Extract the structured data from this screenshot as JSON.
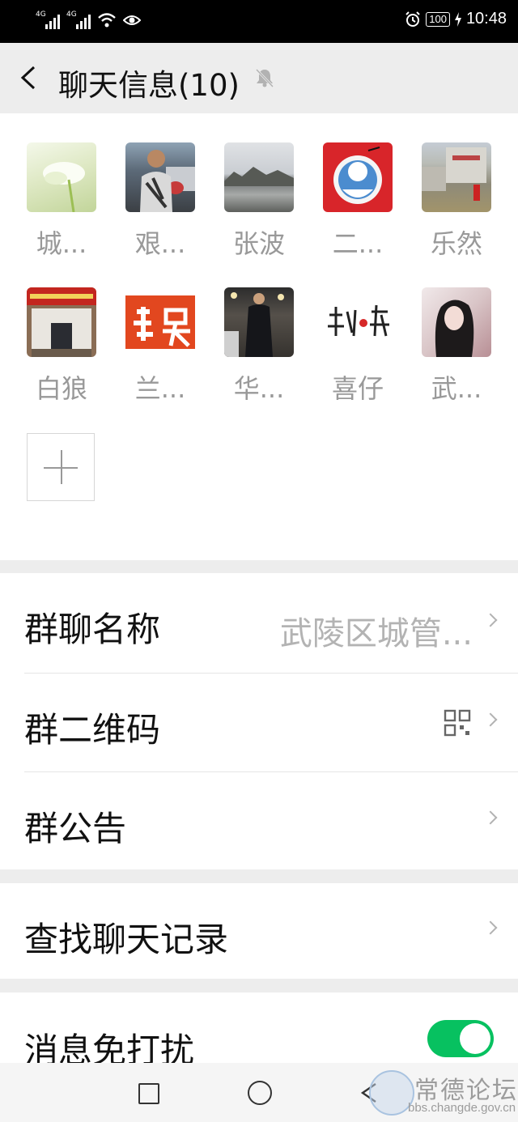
{
  "status_bar": {
    "signal1_tag": "4G",
    "signal2_tag": "4G",
    "battery": "100",
    "time": "10:48"
  },
  "header": {
    "title": "聊天信息(10)"
  },
  "members": [
    {
      "name": "城..."
    },
    {
      "name": "艰..."
    },
    {
      "name": "张波"
    },
    {
      "name": "二..."
    },
    {
      "name": "乐然"
    },
    {
      "name": "白狼"
    },
    {
      "name": "兰..."
    },
    {
      "name": "华..."
    },
    {
      "name": "喜仔"
    },
    {
      "name": "武..."
    }
  ],
  "settings": {
    "group_name_label": "群聊名称",
    "group_name_value": "武陵区城管...",
    "group_qr_label": "群二维码",
    "group_notice_label": "群公告",
    "search_history_label": "查找聊天记录",
    "mute_label": "消息免打扰",
    "mute_on": true
  },
  "watermark": {
    "text": "常德论坛",
    "url": "bbs.changde.gov.cn"
  },
  "colors": {
    "toggle_on": "#07c160",
    "bg": "#ededed"
  }
}
